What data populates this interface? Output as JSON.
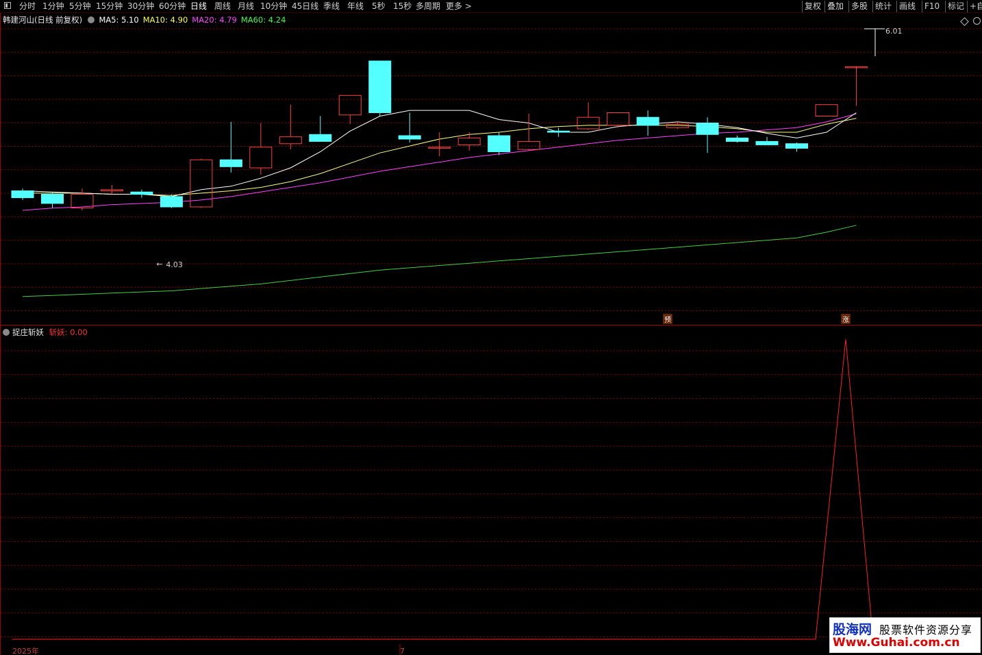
{
  "toolbar": {
    "left_items": [
      "分时",
      "1分钟",
      "5分钟",
      "15分钟",
      "30分钟",
      "60分钟",
      "日线",
      "周线",
      "月线",
      "10分钟",
      "45日线",
      "季线",
      "年线",
      "5秒",
      "15秒",
      "多周期",
      "更多 >"
    ],
    "active_item": "日线",
    "right_items": [
      "复权",
      "叠加",
      "多股",
      "统计",
      "画线",
      "F10",
      "标记",
      "+自"
    ]
  },
  "main_chart": {
    "stock_name": "韩建河山",
    "period_label": "(日线 前复权)",
    "ma": [
      {
        "label": "MA5:",
        "value": "5.10",
        "color": "#ffffff"
      },
      {
        "label": "MA10:",
        "value": "4.90",
        "color": "#ffff40"
      },
      {
        "label": "MA20:",
        "value": "4.79",
        "color": "#ff40ff"
      },
      {
        "label": "MA60:",
        "value": "4.24",
        "color": "#40ff40"
      }
    ],
    "high_label": "6.01",
    "low_label": "4.03",
    "marker_pre": "预",
    "marker_up": "涨",
    "colors": {
      "up": "#ff4040",
      "down": "#54ffff",
      "ma5": "#ffffff",
      "ma10": "#ffff80",
      "ma20": "#ff40ff",
      "ma60": "#40d040",
      "grid": "#8a0000"
    }
  },
  "chart_data": {
    "type": "candlestick",
    "title": "韩建河山 (日线 前复权)",
    "y_range": [
      3.66,
      6.14
    ],
    "candles": [
      {
        "o": 4.73,
        "h": 4.75,
        "l": 4.65,
        "c": 4.67
      },
      {
        "o": 4.7,
        "h": 4.72,
        "l": 4.58,
        "c": 4.62
      },
      {
        "o": 4.58,
        "h": 4.75,
        "l": 4.56,
        "c": 4.7
      },
      {
        "o": 4.73,
        "h": 4.78,
        "l": 4.7,
        "c": 4.74
      },
      {
        "o": 4.72,
        "h": 4.74,
        "l": 4.67,
        "c": 4.7
      },
      {
        "o": 4.68,
        "h": 4.7,
        "l": 4.58,
        "c": 4.59
      },
      {
        "o": 4.59,
        "h": 5.01,
        "l": 4.58,
        "c": 5.0
      },
      {
        "o": 5.0,
        "h": 5.33,
        "l": 4.89,
        "c": 4.94
      },
      {
        "o": 4.93,
        "h": 5.32,
        "l": 4.87,
        "c": 5.11
      },
      {
        "o": 5.14,
        "h": 5.48,
        "l": 5.09,
        "c": 5.2
      },
      {
        "o": 5.22,
        "h": 5.38,
        "l": 5.16,
        "c": 5.16
      },
      {
        "o": 5.39,
        "h": 5.56,
        "l": 5.31,
        "c": 5.56
      },
      {
        "o": 5.86,
        "h": 5.86,
        "l": 5.38,
        "c": 5.41
      },
      {
        "o": 5.21,
        "h": 5.41,
        "l": 5.15,
        "c": 5.18
      },
      {
        "o": 5.11,
        "h": 5.24,
        "l": 5.03,
        "c": 5.11
      },
      {
        "o": 5.13,
        "h": 5.24,
        "l": 5.08,
        "c": 5.19
      },
      {
        "o": 5.21,
        "h": 5.24,
        "l": 5.04,
        "c": 5.07
      },
      {
        "o": 5.09,
        "h": 5.4,
        "l": 5.08,
        "c": 5.16
      },
      {
        "o": 5.25,
        "h": 5.28,
        "l": 5.2,
        "c": 5.24
      },
      {
        "o": 5.27,
        "h": 5.5,
        "l": 5.26,
        "c": 5.37
      },
      {
        "o": 5.3,
        "h": 5.41,
        "l": 5.28,
        "c": 5.41
      },
      {
        "o": 5.37,
        "h": 5.43,
        "l": 5.21,
        "c": 5.3
      },
      {
        "o": 5.28,
        "h": 5.33,
        "l": 5.27,
        "c": 5.31
      },
      {
        "o": 5.32,
        "h": 5.37,
        "l": 5.06,
        "c": 5.22
      },
      {
        "o": 5.19,
        "h": 5.21,
        "l": 5.15,
        "c": 5.16
      },
      {
        "o": 5.16,
        "h": 5.2,
        "l": 5.14,
        "c": 5.13
      },
      {
        "o": 5.14,
        "h": 5.15,
        "l": 5.07,
        "c": 5.1
      },
      {
        "o": 5.38,
        "h": 5.48,
        "l": 5.38,
        "c": 5.48
      },
      {
        "o": 5.81,
        "h": 5.81,
        "l": 5.47,
        "c": 5.81
      }
    ],
    "ma5": [
      4.73,
      4.72,
      4.71,
      4.7,
      4.7,
      4.68,
      4.74,
      4.77,
      4.84,
      4.93,
      5.07,
      5.25,
      5.38,
      5.43,
      5.43,
      5.43,
      5.35,
      5.32,
      5.24,
      5.24,
      5.29,
      5.31,
      5.33,
      5.31,
      5.28,
      5.23,
      5.19,
      5.24,
      5.41
    ],
    "ma10": [
      4.71,
      4.71,
      4.71,
      4.7,
      4.7,
      4.69,
      4.71,
      4.73,
      4.76,
      4.81,
      4.88,
      4.97,
      5.06,
      5.12,
      5.18,
      5.22,
      5.24,
      5.27,
      5.29,
      5.3,
      5.3,
      5.3,
      5.3,
      5.29,
      5.27,
      5.24,
      5.24,
      5.31,
      5.36
    ],
    "ma20": [
      4.56,
      4.58,
      4.59,
      4.61,
      4.62,
      4.63,
      4.65,
      4.68,
      4.72,
      4.76,
      4.8,
      4.85,
      4.9,
      4.94,
      4.98,
      5.02,
      5.05,
      5.08,
      5.11,
      5.14,
      5.17,
      5.19,
      5.21,
      5.23,
      5.24,
      5.26,
      5.28,
      5.33,
      5.4
    ],
    "ma60": [
      3.81,
      3.82,
      3.83,
      3.84,
      3.85,
      3.86,
      3.88,
      3.9,
      3.92,
      3.95,
      3.98,
      4.01,
      4.04,
      4.06,
      4.08,
      4.1,
      4.12,
      4.14,
      4.16,
      4.18,
      4.2,
      4.22,
      4.24,
      4.26,
      4.28,
      4.3,
      4.32,
      4.37,
      4.43
    ]
  },
  "sub_chart": {
    "name": "捉庄斩妖",
    "series_label": "斩妖:",
    "value": "0.00",
    "values": [
      0,
      0,
      0,
      0,
      0,
      0,
      0,
      0,
      0,
      0,
      0,
      0,
      0,
      0,
      0,
      0,
      0,
      0,
      0,
      0,
      0,
      0,
      0,
      0,
      0,
      0,
      0,
      0,
      0,
      1.0,
      0
    ],
    "x_labels": [
      "2025年",
      "7"
    ]
  },
  "watermark": {
    "logo": "股海网",
    "slogan": "股票软件资源分享",
    "url": "Www.Guhai.com.cn"
  }
}
